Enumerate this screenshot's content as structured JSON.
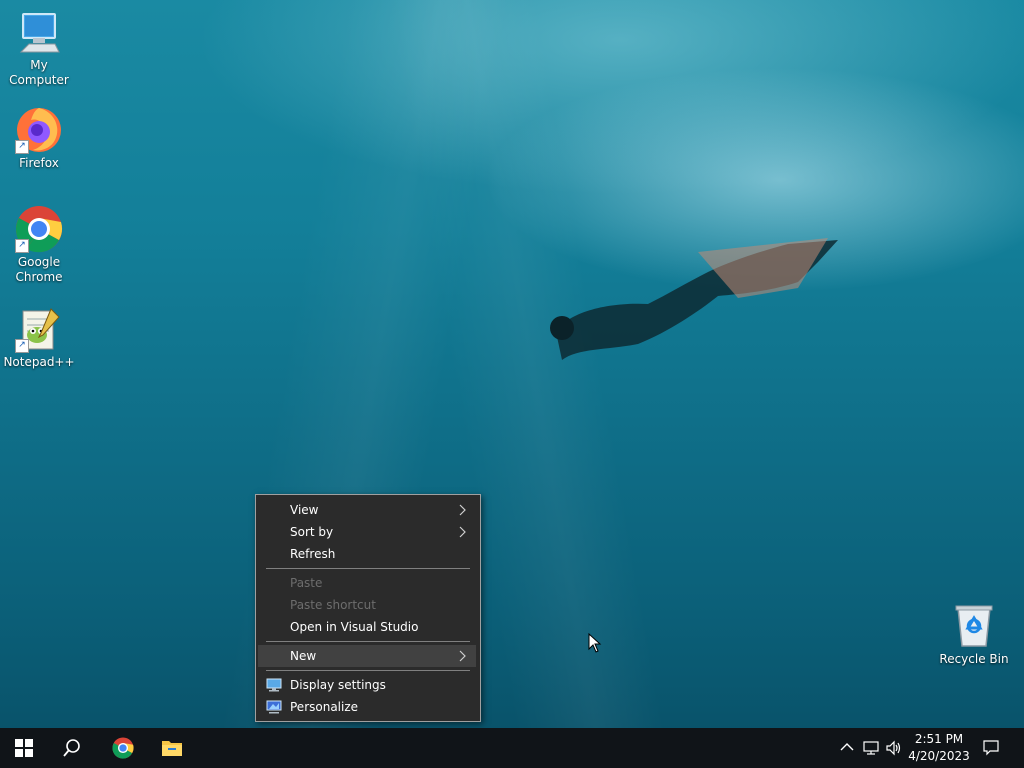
{
  "desktop": {
    "icons": [
      {
        "label": "My Computer",
        "icon": "computer-icon"
      },
      {
        "label": "Firefox",
        "icon": "firefox-icon"
      },
      {
        "label": "Google Chrome",
        "icon": "chrome-icon"
      },
      {
        "label": "Notepad++",
        "icon": "notepad-plus-plus-icon"
      }
    ],
    "recycle_bin": {
      "label": "Recycle Bin",
      "icon": "recycle-bin-icon"
    }
  },
  "context_menu": {
    "items": [
      {
        "label": "View",
        "submenu": true,
        "enabled": true
      },
      {
        "label": "Sort by",
        "submenu": true,
        "enabled": true
      },
      {
        "label": "Refresh",
        "submenu": false,
        "enabled": true
      },
      {
        "label": "Paste",
        "submenu": false,
        "enabled": false
      },
      {
        "label": "Paste shortcut",
        "submenu": false,
        "enabled": false
      },
      {
        "label": "Open in Visual Studio",
        "submenu": false,
        "enabled": true
      },
      {
        "label": "New",
        "submenu": true,
        "enabled": true,
        "highlighted": true
      },
      {
        "label": "Display settings",
        "submenu": false,
        "enabled": true,
        "icon": "display-settings-icon"
      },
      {
        "label": "Personalize",
        "submenu": false,
        "enabled": true,
        "icon": "personalize-icon"
      }
    ]
  },
  "taskbar": {
    "buttons": [
      {
        "name": "start",
        "icon": "windows-logo-icon"
      },
      {
        "name": "search",
        "icon": "search-icon"
      },
      {
        "name": "chrome",
        "icon": "chrome-icon"
      },
      {
        "name": "file-explorer",
        "icon": "folder-icon"
      }
    ],
    "tray": {
      "icons": [
        "chevron-up-icon",
        "network-icon",
        "volume-icon"
      ],
      "time": "2:51 PM",
      "date": "4/20/2023",
      "notification_icon": "notification-icon"
    }
  },
  "colors": {
    "menu_bg": "#2b2b2b",
    "menu_hover": "#414141",
    "menu_disabled_text": "#6d6d6d",
    "taskbar_bg": "#101418"
  }
}
